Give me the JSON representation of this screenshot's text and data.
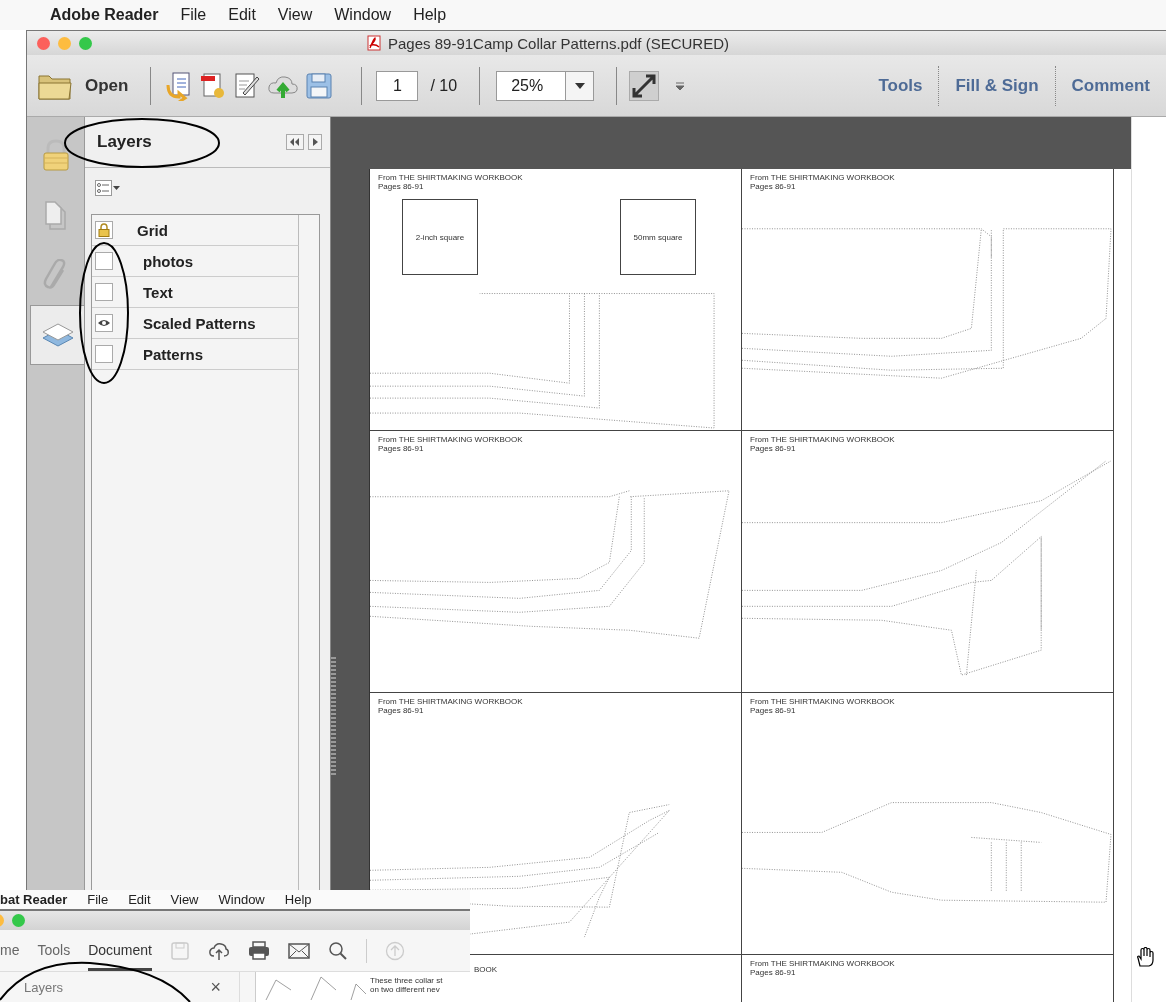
{
  "menubar": {
    "app": "Adobe Reader",
    "items": [
      "File",
      "Edit",
      "View",
      "Window",
      "Help"
    ]
  },
  "window": {
    "title": "Pages 89-91Camp Collar Patterns.pdf (SECURED)"
  },
  "toolbar": {
    "open": "Open",
    "page": "1",
    "page_total": "/ 10",
    "zoom": "25%",
    "links": [
      "Tools",
      "Fill & Sign",
      "Comment"
    ]
  },
  "sidebar_rail": [
    {
      "kind": "lock",
      "selected": false
    },
    {
      "kind": "pages",
      "selected": false
    },
    {
      "kind": "attachments",
      "selected": false
    },
    {
      "kind": "layers",
      "selected": true
    }
  ],
  "layers_panel": {
    "title": "Layers",
    "layers": [
      {
        "name": "Grid",
        "kind": "locked"
      },
      {
        "name": "photos",
        "kind": "toggle",
        "visible": false
      },
      {
        "name": "Text",
        "kind": "toggle",
        "visible": false
      },
      {
        "name": "Scaled Patterns",
        "kind": "toggle",
        "visible": true
      },
      {
        "name": "Patterns",
        "kind": "toggle",
        "visible": false
      }
    ]
  },
  "pages": [
    {
      "kind": "full",
      "header": [
        "From THE SHIRTMAKING WORKBOOK",
        "Pages 86-91"
      ],
      "squares": [
        "2-inch square",
        "50mm square"
      ]
    },
    {
      "kind": "full",
      "header": [
        "From THE SHIRTMAKING WORKBOOK",
        "Pages 86-91"
      ]
    },
    {
      "kind": "full",
      "header": [
        "From THE SHIRTMAKING WORKBOOK",
        "Pages 86-91"
      ]
    },
    {
      "kind": "full",
      "header": [
        "From THE SHIRTMAKING WORKBOOK",
        "Pages 86-91"
      ]
    },
    {
      "kind": "full",
      "header": [
        "From THE SHIRTMAKING WORKBOOK",
        "Pages 86-91"
      ]
    },
    {
      "kind": "full",
      "header": [
        "From THE SHIRTMAKING WORKBOOK",
        "Pages 86-91"
      ]
    },
    {
      "kind": "covered",
      "header": [
        "BOOK"
      ]
    },
    {
      "kind": "full",
      "header": [
        "From THE SHIRTMAKING WORKBOOK",
        "Pages 86-91"
      ]
    }
  ],
  "inset": {
    "menubar": {
      "app": "bat Reader",
      "items": [
        "File",
        "Edit",
        "View",
        "Window",
        "Help"
      ]
    },
    "tabs": [
      {
        "label": "me",
        "selected": false
      },
      {
        "label": "Tools",
        "selected": false
      },
      {
        "label": "Document",
        "selected": true
      }
    ],
    "panel_title": "Layers",
    "close": "×",
    "thumbnail_text": [
      "These three collar st",
      "on two different nev"
    ]
  }
}
